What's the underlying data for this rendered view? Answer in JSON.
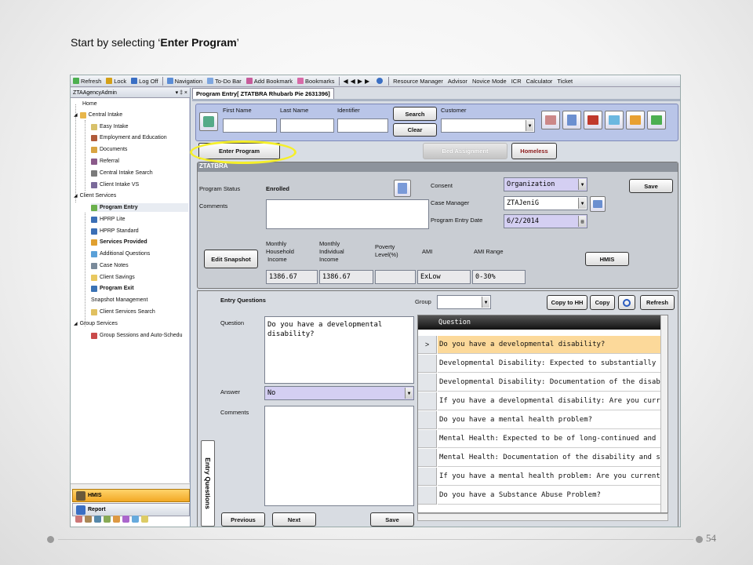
{
  "slide": {
    "title_prefix": "Start by selecting ‘",
    "title_emphasis": "Enter Program",
    "title_suffix": "’",
    "page_number": "54"
  },
  "toolbar": {
    "items": [
      "Refresh",
      "Lock",
      "Log Off",
      "Navigation",
      "To-Do Bar",
      "Add Bookmark",
      "Bookmarks",
      "Resource Manager",
      "Advisor",
      "Novice Mode",
      "ICR",
      "Calculator",
      "Ticket"
    ]
  },
  "sidebar": {
    "agency": "ZTAAgencyAdmin",
    "header_controls": "▾ ‡ ×",
    "tree": [
      {
        "label": "Home",
        "bold": false
      },
      {
        "label": "Central Intake",
        "bold": false
      },
      {
        "label": "Easy Intake",
        "bold": false
      },
      {
        "label": "Employment and Education",
        "bold": false
      },
      {
        "label": "Documents",
        "bold": false
      },
      {
        "label": "Referral",
        "bold": false
      },
      {
        "label": "Central Intake Search",
        "bold": false
      },
      {
        "label": "Client Intake VS",
        "bold": false
      },
      {
        "label": "Client Services",
        "bold": false
      },
      {
        "label": "Program Entry",
        "bold": true
      },
      {
        "label": "HPRP Lite",
        "bold": false
      },
      {
        "label": "HPRP Standard",
        "bold": false
      },
      {
        "label": "Services Provided",
        "bold": true
      },
      {
        "label": "Additional Questions",
        "bold": false
      },
      {
        "label": "Case Notes",
        "bold": false
      },
      {
        "label": "Client Savings",
        "bold": false
      },
      {
        "label": "Program Exit",
        "bold": true
      },
      {
        "label": "Snapshot Management",
        "bold": false
      },
      {
        "label": "Client Services Search",
        "bold": false
      },
      {
        "label": "Group Services",
        "bold": false
      },
      {
        "label": "Group Sessions and Auto-Schedu",
        "bold": false
      }
    ],
    "pane_hmis": "HMIS",
    "pane_report": "Report"
  },
  "main": {
    "tab_label": "Program Entry[ ZTATBRA Rhubarb Pie 2631396]",
    "search": {
      "first_name_label": "First Name",
      "last_name_label": "Last Name",
      "identifier_label": "Identifier",
      "customer_label": "Customer",
      "search_button": "Search",
      "clear_button": "Clear"
    },
    "actions": {
      "enter_program": "Enter Program",
      "bed_assignment": "Bed Assignment",
      "homeless": "Homeless"
    },
    "program": {
      "section_title": "ZTATBRA",
      "status_label": "Program Status",
      "status_value": "Enrolled",
      "comments_label": "Comments",
      "consent_label": "Consent",
      "consent_value": "Organization",
      "case_manager_label": "Case Manager",
      "case_manager_value": "ZTAJeniG",
      "entry_date_label": "Program Entry Date",
      "entry_date_value": "6/2/2014",
      "save_button": "Save",
      "edit_snapshot_button": "Edit Snapshot",
      "hmis_button": "HMIS",
      "monthly_household_label": "Monthly\nHousehold\n Income",
      "monthly_individual_label": "Monthly\nIndividual\nIncome",
      "poverty_label": "Poverty\nLevel(%)",
      "ami_label": "AMI",
      "ami_range_label": "AMI Range",
      "monthly_household_value": "1386.67",
      "monthly_individual_value": "1386.67",
      "poverty_value": "",
      "ami_value": "ExLow",
      "ami_range_value": "0-30%"
    },
    "entry": {
      "title": "Entry Questions",
      "vertical_tab": "Entry Questions",
      "group_label": "Group",
      "question_label": "Question",
      "question_text": "Do you have a developmental disability?",
      "answer_label": "Answer",
      "answer_value": "No",
      "comments_label": "Comments",
      "copy_to_hh": "Copy to HH",
      "copy": "Copy",
      "refresh": "Refresh",
      "previous": "Previous",
      "next": "Next",
      "save": "Save",
      "grid_header": "Question",
      "grid_rows": [
        "Do you have a developmental disability?",
        "Developmental Disability: Expected to substantially impair a",
        "Developmental Disability: Documentation of the disability an",
        "If you have a developmental disability: Are you currently rec",
        "Do you have a mental health problem?",
        "Mental Health: Expected to be of long-continued and indefin",
        "Mental Health: Documentation of the disability and severity",
        "If you have a mental health problem: Are you currently rece",
        "Do you have a Substance Abuse Problem?"
      ],
      "selected_row_marker": ">"
    }
  },
  "colors": {
    "highlight_ellipse": "#f5ef2a",
    "selected_row": "#fcd99a",
    "search_panel": "#b9c5e8",
    "purple_input": "#d4cff2"
  }
}
